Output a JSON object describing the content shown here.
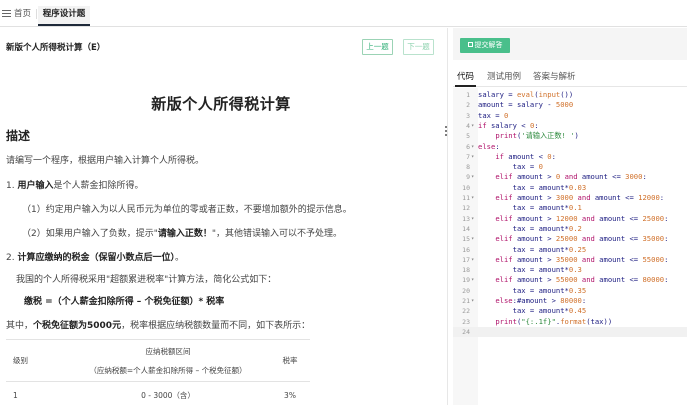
{
  "tabs": {
    "home": "首页",
    "active": "程序设计题"
  },
  "question": {
    "title": "新版个人所得税计算（E）",
    "prev_label": "上一题",
    "next_label": "下一题",
    "doc_title": "新版个人所得税计算",
    "desc_heading": "描述",
    "p1": "请编写一个程序，根据用户输入计算个人所得税。",
    "p2_bold": "用户输入",
    "p2_prefix": "1. ",
    "p2_rest": "是个人薪金扣除所得。",
    "p3": "（1）约定用户输入为以人民币元为单位的零或者正数，不要增加额外的提示信息。",
    "p4_a": "（2）如果用户输入了负数，提示\"",
    "p4_bold": "请输入正数！",
    "p4_b": "\"，其他错误输入可以不予处理。",
    "p5_prefix": "2. ",
    "p5_bold": "计算应缴纳的税金（保留小数点后一位）",
    "p5_rest": "。",
    "p6": "我国的个人所得税采用\"超额累进税率\"计算方法，简化公式如下：",
    "p7": "缴税 =（个人薪金扣除所得 – 个税免征额）* 税率",
    "p8_a": "其中，",
    "p8_bold": "个税免征额为5000元",
    "p8_b": "，税率根据应纳税额数量而不同，如下表所示：",
    "table": {
      "col_level": "级别",
      "col_range_title": "应纳税额区间",
      "col_range_sub": "（应纳税额=个人薪金扣除所得 – 个税免征额）",
      "col_rate": "税率",
      "rows": [
        {
          "level": "1",
          "range": "0 - 3000（含）",
          "rate": "3%"
        }
      ]
    }
  },
  "right": {
    "submit_label": "提交解答",
    "tabs": [
      "代码",
      "测试用例",
      "答案与解析"
    ]
  },
  "code_lines": [
    {
      "n": "1",
      "fold": "",
      "html": "salary = <span class=\"n\">eval</span>(<span class=\"n\">input</span>())"
    },
    {
      "n": "2",
      "fold": "",
      "html": "amount = salary - <span class=\"n\">5000</span>"
    },
    {
      "n": "3",
      "fold": "",
      "html": "tax = <span class=\"n\">0</span>"
    },
    {
      "n": "4",
      "fold": "▾",
      "html": "<span class=\"k\">if</span> salary &lt; <span class=\"n\">0</span>:"
    },
    {
      "n": "5",
      "fold": "",
      "html": "    <span class=\"k\">print</span>(<span class=\"s\">'请输入正数! '</span>)"
    },
    {
      "n": "6",
      "fold": "▾",
      "html": "<span class=\"k\">else</span>:"
    },
    {
      "n": "7",
      "fold": "▾",
      "html": "    <span class=\"k\">if</span> amount &lt; <span class=\"n\">0</span>:"
    },
    {
      "n": "8",
      "fold": "",
      "html": "        tax = <span class=\"n\">0</span>"
    },
    {
      "n": "9",
      "fold": "▾",
      "html": "    <span class=\"k\">elif</span> amount &gt; <span class=\"n\">0</span> <span class=\"k\">and</span> amount &lt;= <span class=\"n\">3000</span>:"
    },
    {
      "n": "10",
      "fold": "",
      "html": "        tax = amount*<span class=\"n\">0.03</span>"
    },
    {
      "n": "11",
      "fold": "▾",
      "html": "    <span class=\"k\">elif</span> amount &gt; <span class=\"n\">3000</span> <span class=\"k\">and</span> amount &lt;= <span class=\"n\">12000</span>:"
    },
    {
      "n": "12",
      "fold": "",
      "html": "        tax = amount*<span class=\"n\">0.1</span>"
    },
    {
      "n": "13",
      "fold": "▾",
      "html": "    <span class=\"k\">elif</span> amount &gt; <span class=\"n\">12000</span> <span class=\"k\">and</span> amount &lt;= <span class=\"n\">25000</span>:"
    },
    {
      "n": "14",
      "fold": "",
      "html": "        tax = amount*<span class=\"n\">0.2</span>"
    },
    {
      "n": "15",
      "fold": "▾",
      "html": "    <span class=\"k\">elif</span> amount &gt; <span class=\"n\">25000</span> <span class=\"k\">and</span> amount &lt;= <span class=\"n\">35000</span>:"
    },
    {
      "n": "16",
      "fold": "",
      "html": "        tax = amount*<span class=\"n\">0.25</span>"
    },
    {
      "n": "17",
      "fold": "▾",
      "html": "    <span class=\"k\">elif</span> amount &gt; <span class=\"n\">35000</span> <span class=\"k\">and</span> amount &lt;= <span class=\"n\">55000</span>:"
    },
    {
      "n": "18",
      "fold": "",
      "html": "        tax = amount*<span class=\"n\">0.3</span>"
    },
    {
      "n": "19",
      "fold": "▾",
      "html": "    <span class=\"k\">elif</span> amount &gt; <span class=\"n\">55000</span> <span class=\"k\">and</span> amount &lt;= <span class=\"n\">80000</span>:"
    },
    {
      "n": "20",
      "fold": "",
      "html": "        tax = amount*<span class=\"n\">0.35</span>"
    },
    {
      "n": "21",
      "fold": "▾",
      "html": "    <span class=\"k\">else</span>:#amount &gt; <span class=\"n\">80000</span>:"
    },
    {
      "n": "22",
      "fold": "",
      "html": "        tax = amount*<span class=\"n\">0.45</span>"
    },
    {
      "n": "23",
      "fold": "",
      "html": "    <span class=\"k\">print</span>(<span class=\"s\">\"{:.1f}\"</span>.<span class=\"n\">format</span>(tax))"
    },
    {
      "n": "24",
      "fold": "",
      "html": ""
    }
  ]
}
